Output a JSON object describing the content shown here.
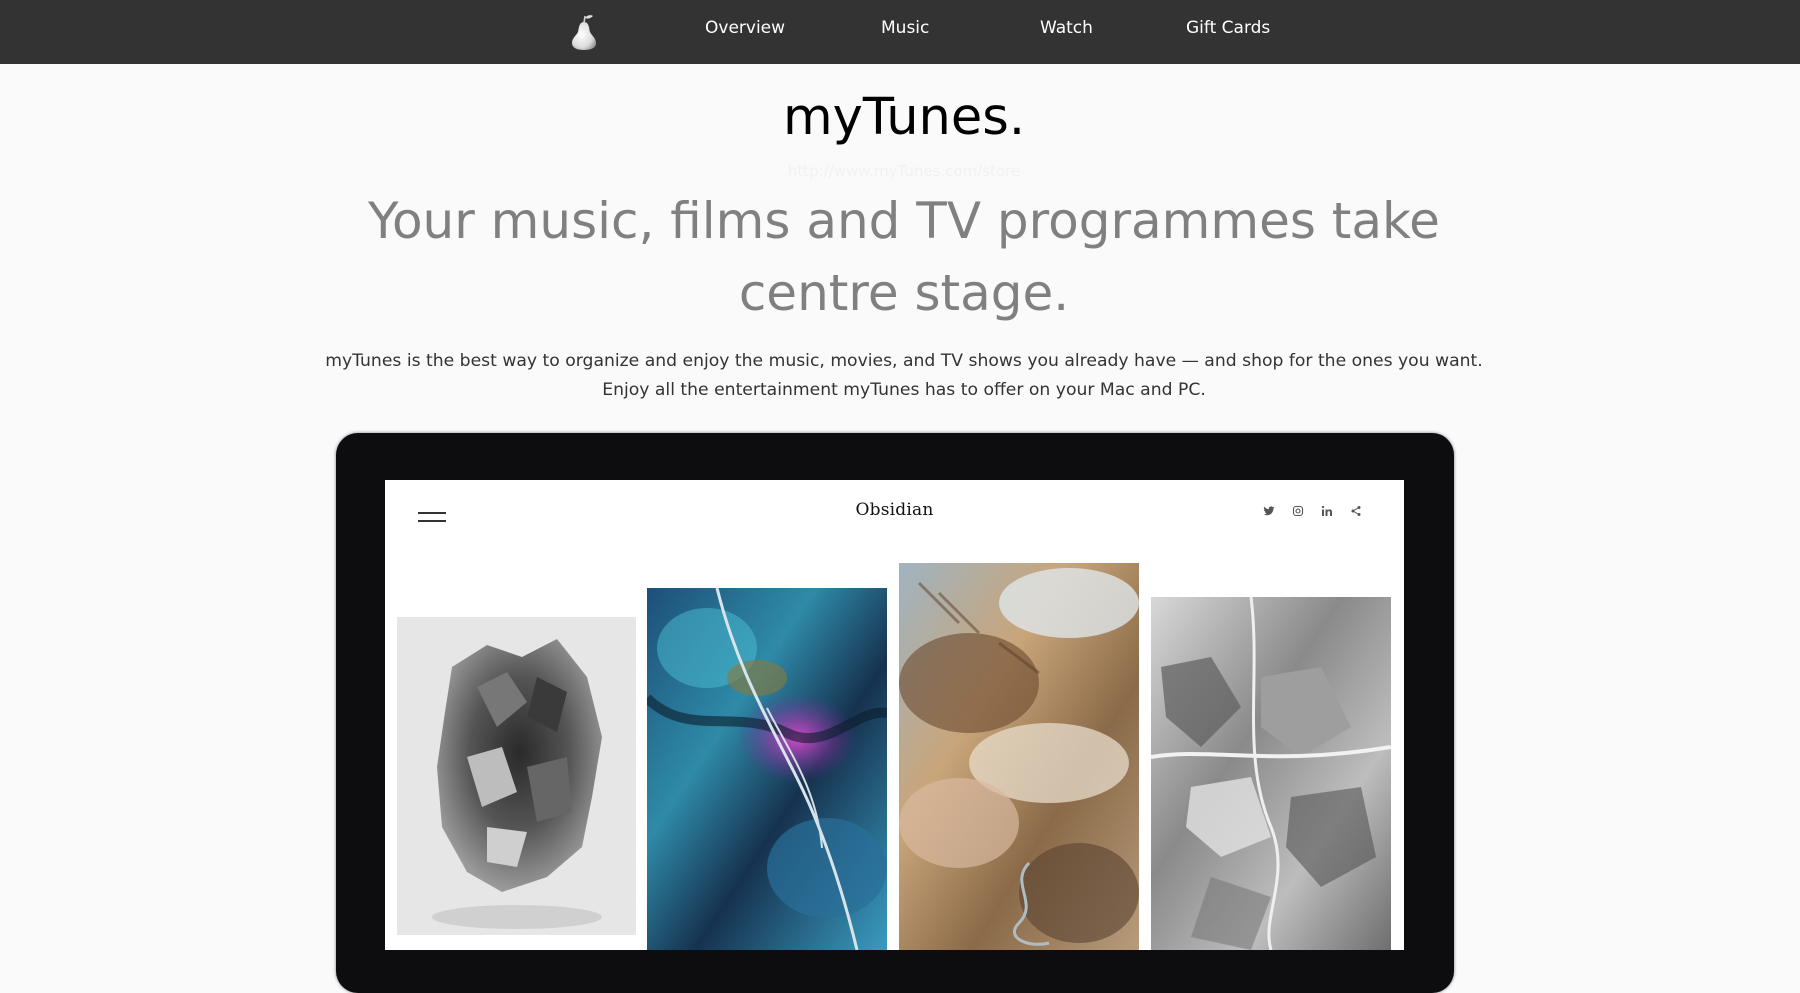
{
  "nav": {
    "logo_icon": "pear-icon",
    "links": [
      "Overview",
      "Music",
      "Watch",
      "Gift Cards"
    ]
  },
  "hero": {
    "title": "myTunes.",
    "url_text": "http://www.myTunes.com/store",
    "heading": "Your music, films and TV programmes take centre stage.",
    "description": "myTunes is the best way to organize and enjoy the music, movies, and TV shows you already have — and shop for the ones you want. Enjoy all the entertainment myTunes has to offer on your Mac and PC."
  },
  "mockup": {
    "brand": "Obsidian",
    "menu_icon": "hamburger-menu-icon",
    "social_icons": [
      "twitter-icon",
      "instagram-icon",
      "linkedin-icon",
      "share-icon"
    ],
    "tiles": [
      "grayscale-crystal-image",
      "blue-mineral-image",
      "desert-aerial-image",
      "marble-texture-image"
    ]
  },
  "colors": {
    "nav_bg": "#333333",
    "page_bg": "#fafafa",
    "heading_gray": "#808080",
    "device_frame": "#0d0d0f"
  }
}
